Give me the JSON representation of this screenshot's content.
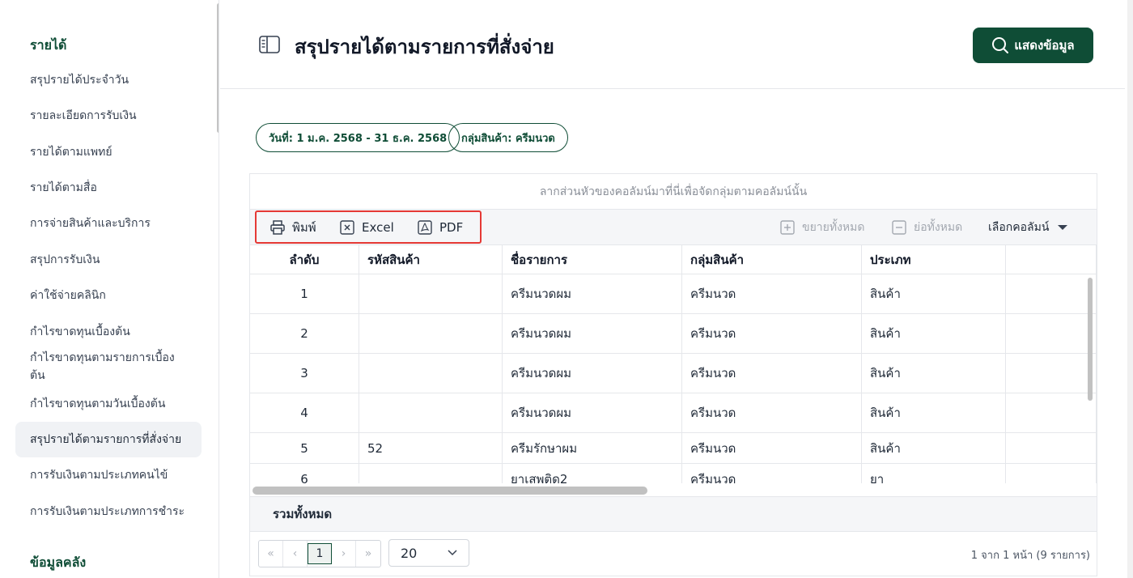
{
  "sidebar": {
    "section_income": "รายได้",
    "items": [
      {
        "label": "สรุปรายได้ประจำวัน"
      },
      {
        "label": "รายละเอียดการรับเงิน"
      },
      {
        "label": "รายได้ตามแพทย์"
      },
      {
        "label": "รายได้ตามสื่อ"
      },
      {
        "label": "การจ่ายสินค้าและบริการ"
      },
      {
        "label": "สรุปการรับเงิน"
      },
      {
        "label": "ค่าใช้จ่ายคลินิก"
      },
      {
        "label": "กำไรขาดทุนเบื้องต้น"
      },
      {
        "label": "กำไรขาดทุนตามรายการเบื้องต้น"
      },
      {
        "label": "กำไรขาดทุนตามวันเบื้องต้น"
      },
      {
        "label": "สรุปรายได้ตามรายการที่สั่งจ่าย"
      },
      {
        "label": "การรับเงินตามประเภทคนไข้"
      },
      {
        "label": "การรับเงินตามประเภทการชำระ"
      }
    ],
    "section_stock": "ข้อมูลคลัง"
  },
  "header": {
    "title": "สรุปรายได้ตามรายการที่สั่งจ่าย",
    "show_button": "แสดงข้อมูล"
  },
  "filters": {
    "date": "วันที่: 1 ม.ค. 2568 - 31 ธ.ค. 2568",
    "group": "กลุ่มสินค้า: ครีมนวด"
  },
  "grid": {
    "group_panel": "ลากส่วนหัวของคอลัมน์มาที่นี่เพื่อจัดกลุ่มตามคอลัมน์นั้น",
    "toolbar": {
      "print": "พิมพ์",
      "excel": "Excel",
      "pdf": "PDF",
      "expand_all": "ขยายทั้งหมด",
      "collapse_all": "ย่อทั้งหมด",
      "column_chooser": "เลือกคอลัมน์"
    },
    "columns": [
      "ลำดับ",
      "รหัสสินค้า",
      "ชื่อรายการ",
      "กลุ่มสินค้า",
      "ประเภท"
    ],
    "rows": [
      {
        "no": "1",
        "code": "",
        "name": "ครีมนวดผม",
        "group": "ครีมนวด",
        "type": "สินค้า"
      },
      {
        "no": "2",
        "code": "",
        "name": "ครีมนวดผม",
        "group": "ครีมนวด",
        "type": "สินค้า"
      },
      {
        "no": "3",
        "code": "",
        "name": "ครีมนวดผม",
        "group": "ครีมนวด",
        "type": "สินค้า"
      },
      {
        "no": "4",
        "code": "",
        "name": "ครีมนวดผม",
        "group": "ครีมนวด",
        "type": "สินค้า"
      },
      {
        "no": "5",
        "code": "52",
        "name": "ครีมรักษาผม",
        "group": "ครีมนวด",
        "type": "สินค้า"
      },
      {
        "no": "6",
        "code": "",
        "name": "ยาเสพติด2",
        "group": "ครีมนวด",
        "type": "ยา"
      }
    ],
    "summary_label": "รวมทั้งหมด",
    "pager": {
      "first": "«",
      "prev": "‹",
      "current": "1",
      "next": "›",
      "last": "»",
      "page_size": "20",
      "info": "1 จาก 1 หน้า (9 รายการ)"
    }
  },
  "colors": {
    "brand": "#0f4d36",
    "highlight": "#e53935"
  }
}
